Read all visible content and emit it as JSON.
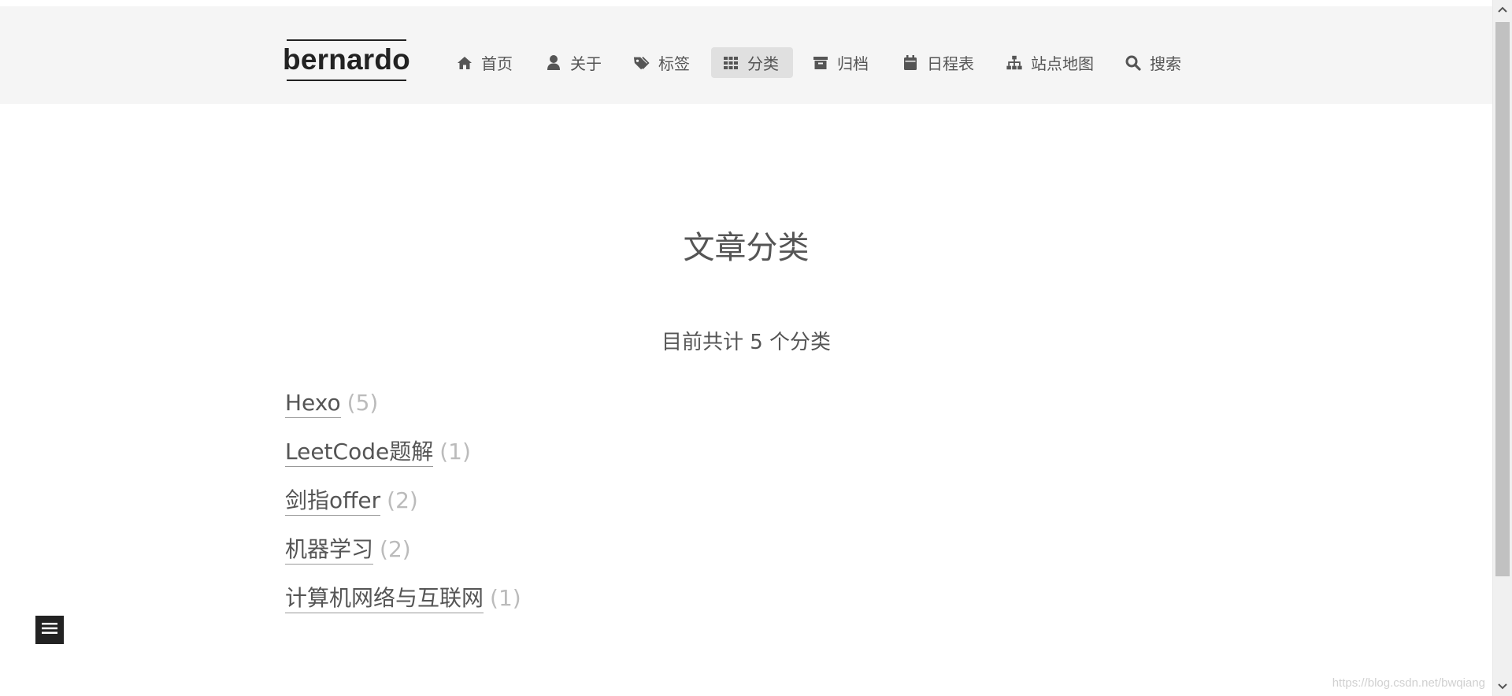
{
  "site": {
    "brand": "bernardo"
  },
  "menu": {
    "items": [
      {
        "label": "首页",
        "icon": "home-icon"
      },
      {
        "label": "关于",
        "icon": "user-icon"
      },
      {
        "label": "标签",
        "icon": "tags-icon"
      },
      {
        "label": "分类",
        "icon": "grid-icon",
        "active": true
      },
      {
        "label": "归档",
        "icon": "archive-icon"
      },
      {
        "label": "日程表",
        "icon": "calendar-icon"
      },
      {
        "label": "站点地图",
        "icon": "sitemap-icon"
      },
      {
        "label": "搜索",
        "icon": "search-icon"
      }
    ]
  },
  "page": {
    "title": "文章分类",
    "summary": "目前共计 5 个分类"
  },
  "categories": [
    {
      "name": "Hexo",
      "count": "(5)"
    },
    {
      "name": "LeetCode题解",
      "count": "(1)"
    },
    {
      "name": "剑指offer",
      "count": "(2)"
    },
    {
      "name": "机器学习",
      "count": "(2)"
    },
    {
      "name": "计算机网络与互联网",
      "count": "(1)"
    }
  ],
  "watermark": "https://blog.csdn.net/bwqiang",
  "colors": {
    "header_background": "#f5f5f5",
    "active_menu_background": "#e0e0e0",
    "text": "#555555",
    "count_text": "#bbbbbb",
    "brand": "#222222"
  }
}
